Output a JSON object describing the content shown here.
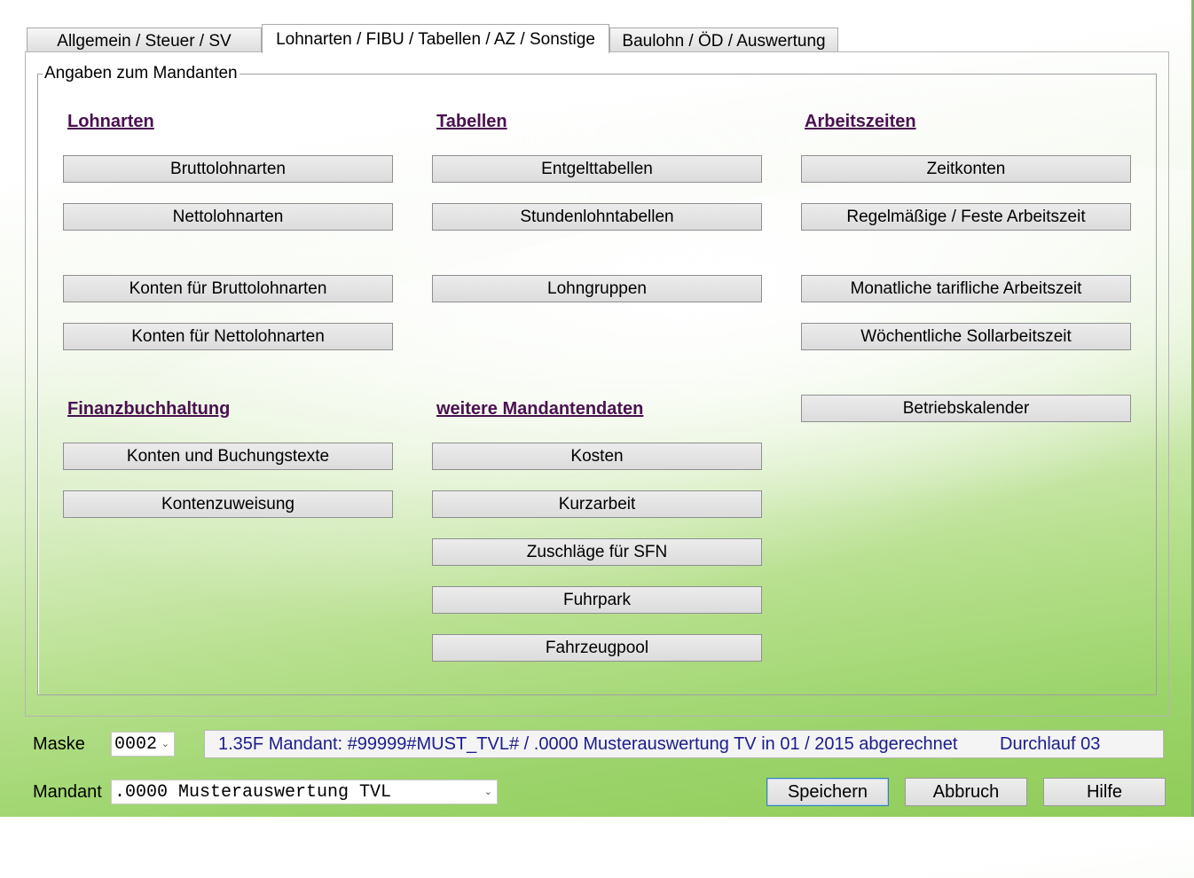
{
  "tabs": [
    {
      "label": "Allgemein / Steuer / SV"
    },
    {
      "label": "Lohnarten / FIBU / Tabellen / AZ / Sonstige"
    },
    {
      "label": "Baulohn / ÖD / Auswertung"
    }
  ],
  "groupbox": {
    "legend": "Angaben zum Mandanten"
  },
  "sections": {
    "lohnarten": "Lohnarten",
    "tabellen": "Tabellen",
    "arbeitszeiten": "Arbeitszeiten",
    "fibu": "Finanzbuchhaltung",
    "weitere": "weitere Mandantendaten"
  },
  "buttons": {
    "bruttolohnarten": "Bruttolohnarten",
    "nettolohnarten": "Nettolohnarten",
    "konten_brutto": "Konten für Bruttolohnarten",
    "konten_netto": "Konten für Nettolohnarten",
    "entgelttabellen": "Entgelttabellen",
    "stundenlohntabellen": "Stundenlohntabellen",
    "lohngruppen": "Lohngruppen",
    "zeitkonten": "Zeitkonten",
    "regelmaessige": "Regelmäßige / Feste Arbeitszeit",
    "monatliche": "Monatliche tarifliche Arbeitszeit",
    "woechentliche": "Wöchentliche Sollarbeitszeit",
    "betriebskalender": "Betriebskalender",
    "konten_buchungstexte": "Konten und Buchungstexte",
    "kontenzuweisung": "Kontenzuweisung",
    "kosten": "Kosten",
    "kurzarbeit": "Kurzarbeit",
    "zuschlaege": "Zuschläge für SFN",
    "fuhrpark": "Fuhrpark",
    "fahrzeugpool": "Fahrzeugpool"
  },
  "bottom": {
    "maske_label": "Maske",
    "maske_value": "0002",
    "status_message": "1.35F Mandant: #99999#MUST_TVL# / .0000 Musterauswertung TV in 01 / 2015 abgerechnet",
    "status_run": "Durchlauf 03",
    "mandant_label": "Mandant",
    "mandant_value": ".0000 Musterauswertung TVL",
    "save": "Speichern",
    "cancel": "Abbruch",
    "help": "Hilfe"
  },
  "icons": {
    "dropdown": "chevron-down-icon"
  },
  "colors": {
    "section_heading": "#4a1050",
    "status_text": "#1c1c8c"
  }
}
